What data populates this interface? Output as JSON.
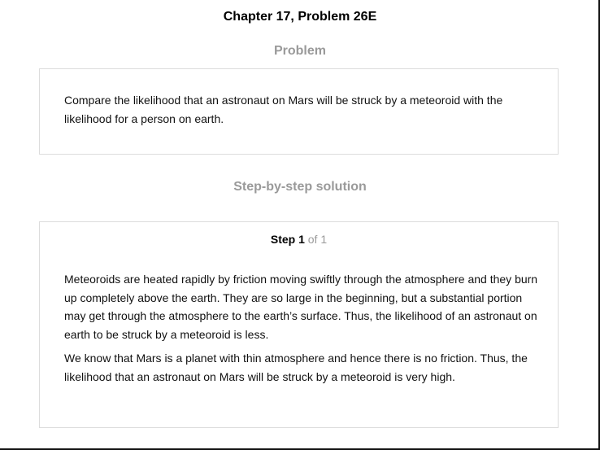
{
  "header": {
    "chapter_title": "Chapter 17, Problem 26E"
  },
  "problem": {
    "heading": "Problem",
    "text": "Compare the likelihood that an astronaut on Mars will be struck by a meteoroid with the likelihood for a person on earth."
  },
  "solution": {
    "heading": "Step-by-step solution",
    "step_word": "Step 1",
    "step_of": "of 1",
    "paragraphs": [
      "Meteoroids are heated rapidly by friction moving swiftly through the atmosphere and they burn up completely above the earth. They are so large in the beginning, but a substantial portion may get through the atmosphere to the earth’s surface. Thus, the likelihood of an astronaut on earth to be struck by a meteoroid is less.",
      "We know that Mars is a planet with thin atmosphere and hence there is no friction. Thus, the likelihood that an astronaut on Mars will be struck by a meteoroid is very high."
    ]
  },
  "colors": {
    "heading_gray": "#9a9a9a",
    "card_border": "#dcdcdc",
    "text": "#111111"
  }
}
